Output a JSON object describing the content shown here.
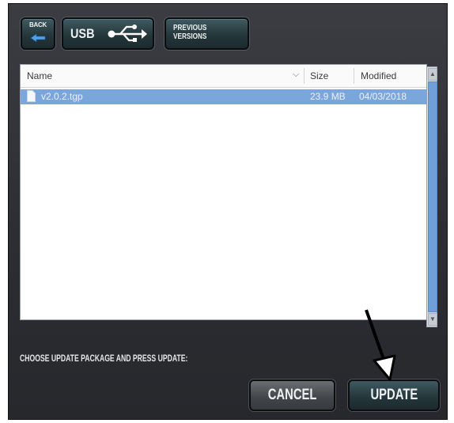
{
  "toolbar": {
    "back_label": "BACK",
    "usb_label": "USB",
    "previous_versions_label": "PREVIOUS VERSIONS"
  },
  "file_list": {
    "columns": [
      "Name",
      "Size",
      "Modified"
    ],
    "rows": [
      {
        "name": "v2.0.2.tgp",
        "size": "23.9 MB",
        "modified": "04/03/2018",
        "selected": true
      }
    ]
  },
  "instruction": "CHOOSE UPDATE PACKAGE AND PRESS UPDATE:",
  "buttons": {
    "cancel_label": "CANCEL",
    "update_label": "UPDATE"
  },
  "colors": {
    "panel_bg": "#2c2e33",
    "button_teal": "#25373b",
    "selection": "#7aa6dc",
    "scroll_thumb": "#6f9ed9"
  },
  "icons": [
    "back-arrow-icon",
    "usb-icon",
    "file-icon",
    "chevron-down-icon",
    "pointer-arrow-icon"
  ]
}
